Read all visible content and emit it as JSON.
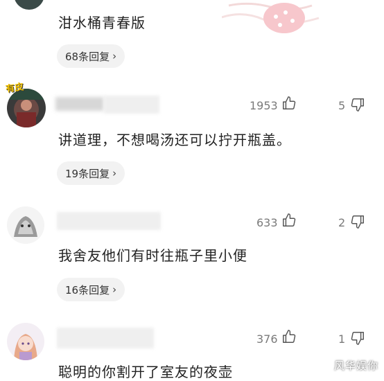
{
  "comments": [
    {
      "text": "泔水桶青春版",
      "replies": "68条回复"
    },
    {
      "avatar_badge": "有皮",
      "text": "讲道理，不想喝汤还可以拧开瓶盖。",
      "likes": "1953",
      "dislikes": "5",
      "replies": "19条回复"
    },
    {
      "text": "我舍友他们有时往瓶子里小便",
      "likes": "633",
      "dislikes": "2",
      "replies": "16条回复"
    },
    {
      "text": "聪明的你割开了室友的夜壶",
      "likes": "376",
      "dislikes": "1"
    }
  ],
  "reply_chevron": "›",
  "watermark": "风华娱你",
  "icons": {
    "like": "thumbs-up-icon",
    "dislike": "thumbs-down-icon",
    "chevron": "chevron-right-icon"
  },
  "colors": {
    "text": "#222222",
    "muted": "#7a7a7a",
    "pill": "#f2f2f2"
  }
}
